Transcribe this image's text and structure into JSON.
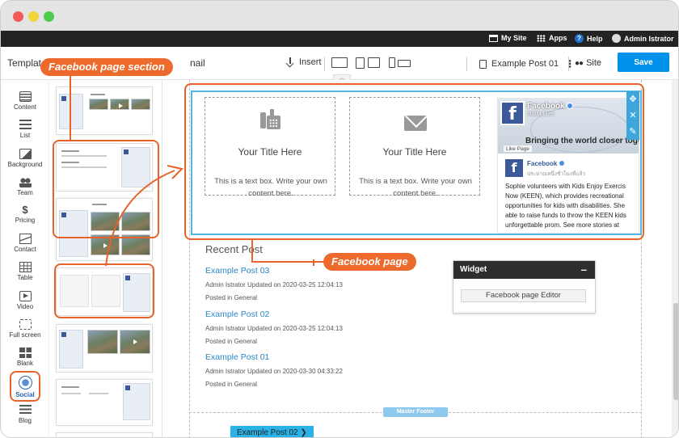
{
  "window": {
    "controls": [
      "close",
      "minimize",
      "maximize"
    ]
  },
  "adminbar": {
    "my_site": "My Site",
    "apps": "Apps",
    "help": "Help",
    "help_glyph": "?",
    "user": "Admin Istrator"
  },
  "toolbar": {
    "template_label": "Templat",
    "template_tail": "nail",
    "insert": "Insert",
    "post_name": "Example Post 01",
    "site": "Site",
    "save": "Save"
  },
  "sidebar": {
    "items": [
      {
        "label": "Content",
        "icon": "content-icon"
      },
      {
        "label": "List",
        "icon": "list-icon"
      },
      {
        "label": "Background",
        "icon": "background-icon"
      },
      {
        "label": "Team",
        "icon": "team-icon"
      },
      {
        "label": "Pricing",
        "icon": "pricing-icon",
        "glyph": "$"
      },
      {
        "label": "Contact",
        "icon": "contact-icon"
      },
      {
        "label": "Table",
        "icon": "table-icon"
      },
      {
        "label": "Video",
        "icon": "video-icon"
      },
      {
        "label": "Full screen",
        "icon": "fullscreen-icon"
      },
      {
        "label": "Blank",
        "icon": "blank-icon"
      },
      {
        "label": "Social",
        "icon": "social-icon",
        "active": true
      },
      {
        "label": "Blog",
        "icon": "blog-icon"
      }
    ]
  },
  "canvas": {
    "cards": [
      {
        "title": "Your Title Here",
        "text": "This is a text box. Write your own content here.",
        "icon": "phone-icon"
      },
      {
        "title": "Your Title Here",
        "text": "This is a text box. Write your own content here.",
        "icon": "mail-icon"
      }
    ],
    "facebook": {
      "logo_glyph": "f",
      "page_name": "Facebook",
      "likes": "208M likes",
      "slogan": "Bringing the world closer toget",
      "like_button": "Like Page",
      "post_author": "Facebook",
      "post_date": "ประมาณหนึ่งชั่วโมงที่แล้ว",
      "post_text": "Sophie volunteers with Kids Enjoy Exercis Now (KEEN), which provides recreational opportunities for kids with disabilities. She able to raise funds to throw the KEEN kids unforgettable prom. See more stories at",
      "tools": [
        "move",
        "close",
        "edit"
      ],
      "tool_glyphs": [
        "✥",
        "✕",
        "✎"
      ]
    },
    "recent": {
      "title": "Recent Post",
      "posts": [
        {
          "title": "Example Post 03",
          "meta": "Admin Istrator Updated on 2020-03-25 12:04:13",
          "category": "Posted in General"
        },
        {
          "title": "Example Post 02",
          "meta": "Admin Istrator Updated on 2020-03-25 12:04:13",
          "category": "Posted in General"
        },
        {
          "title": "Example Post 01",
          "meta": "Admin Istrator Updated on 2020-03-30 04:33:22",
          "category": "Posted in General"
        }
      ]
    },
    "widget": {
      "title": "Widget",
      "minimize": "–",
      "editor_button": "Facebook page Editor"
    },
    "footer": {
      "tag": "Master Footer",
      "button": "Example Post 02",
      "button_arrow": "❯"
    }
  },
  "annotations": {
    "section_label": "Facebook page section",
    "page_label": "Facebook page"
  },
  "colors": {
    "accent": "#e8632b",
    "save": "#0091ea",
    "facebook": "#3b5998",
    "selection": "#55b5e2"
  }
}
